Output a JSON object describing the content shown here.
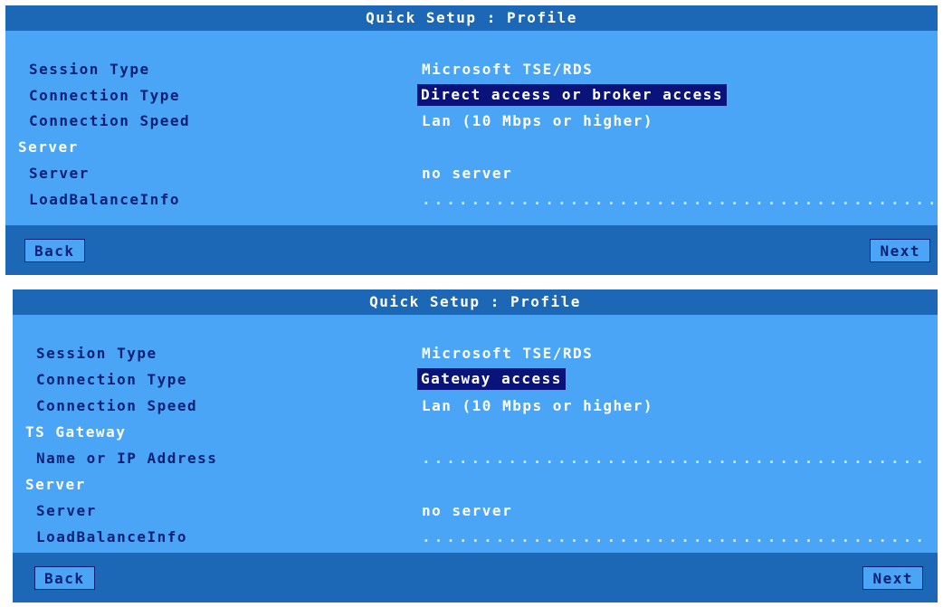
{
  "panels": [
    {
      "title": "Quick Setup : Profile",
      "session_type_label": "Session Type",
      "session_type_value": "Microsoft TSE/RDS",
      "connection_type_label": "Connection Type",
      "connection_type_value": "Direct access or broker access",
      "connection_speed_label": "Connection Speed",
      "connection_speed_value": "Lan (10 Mbps or higher)",
      "server_section": "Server",
      "server_label": "Server",
      "server_value": "no server",
      "lbi_label": "LoadBalanceInfo",
      "lbi_value": ".............................................",
      "back_label": "Back",
      "next_label": "Next"
    },
    {
      "title": "Quick Setup : Profile",
      "session_type_label": "Session Type",
      "session_type_value": "Microsoft TSE/RDS",
      "connection_type_label": "Connection Type",
      "connection_type_value": "Gateway access",
      "connection_speed_label": "Connection Speed",
      "connection_speed_value": "Lan (10 Mbps or higher)",
      "gateway_section": "TS Gateway",
      "gateway_name_label": "Name or IP Address",
      "gateway_name_value": "...........................................",
      "server_section": "Server",
      "server_label": "Server",
      "server_value": "no server",
      "lbi_label": "LoadBalanceInfo",
      "lbi_value": "...........................................",
      "back_label": "Back",
      "next_label": "Next"
    }
  ],
  "colors": {
    "panel_bg": "#4aa5f6",
    "bar_bg": "#1c68b6",
    "label": "#0b1f72",
    "selected_bg": "#09137a"
  }
}
